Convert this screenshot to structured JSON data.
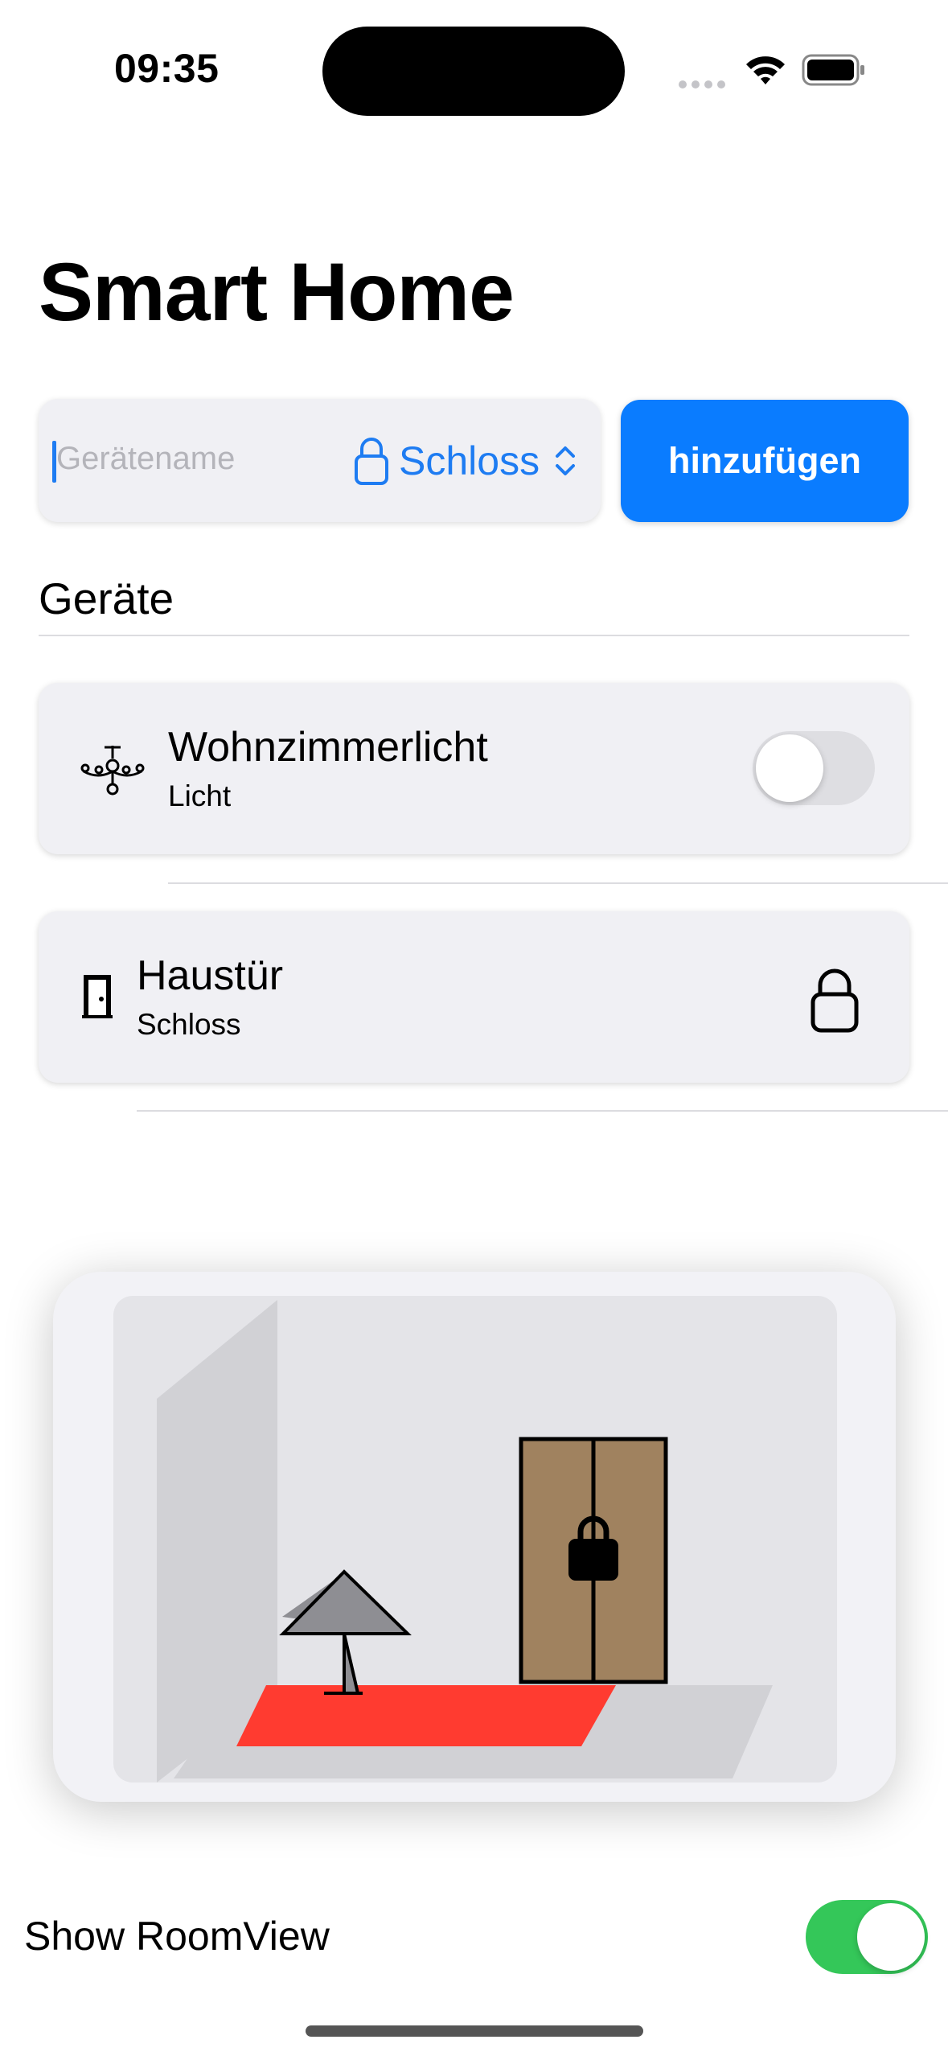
{
  "status_bar": {
    "time": "09:35",
    "signal_icon": "signal-dots-icon",
    "wifi_icon": "wifi-icon",
    "battery_icon": "battery-icon"
  },
  "title": "Smart Home",
  "add_form": {
    "name_placeholder": "Gerätename",
    "name_value": "",
    "type_selected": "Schloss",
    "type_icon": "lock-icon",
    "add_button_label": "hinzufügen"
  },
  "devices_section": {
    "header": "Geräte",
    "items": [
      {
        "name": "Wohnzimmerlicht",
        "type": "Licht",
        "icon": "chandelier-icon",
        "control": "toggle",
        "state": "off"
      },
      {
        "name": "Haustür",
        "type": "Schloss",
        "icon": "door-icon",
        "control": "lock",
        "state": "locked"
      }
    ]
  },
  "room_view": {
    "lamp_state": "off",
    "door_state": "locked"
  },
  "settings": {
    "show_roomview_label": "Show RoomView",
    "show_roomview_enabled": true
  },
  "colors": {
    "accent": "#0a7cff",
    "toggle_on": "#34c759",
    "rug": "#ff3b30",
    "door": "#a0825f",
    "card_bg": "#f0f0f4"
  }
}
